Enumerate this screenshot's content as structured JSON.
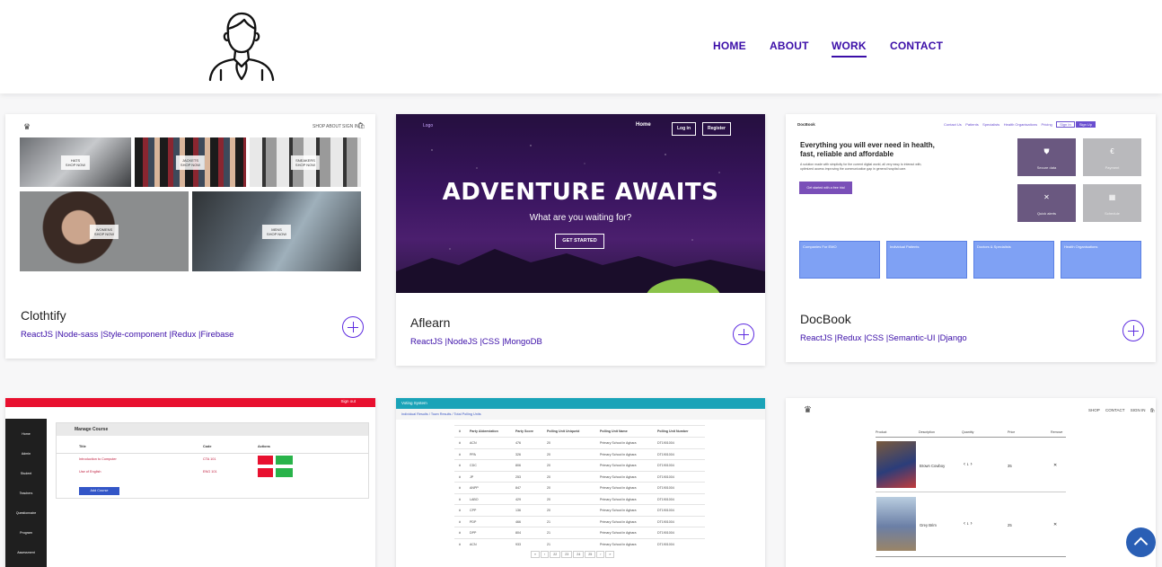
{
  "nav": {
    "items": [
      "HOME",
      "ABOUT",
      "WORK",
      "CONTACT"
    ],
    "active": "WORK"
  },
  "projects": [
    {
      "title": "Clothtify",
      "tags": "ReactJS |Node-sass |Style-component |Redux |Firebase",
      "thumb": {
        "nav": [
          "SHOP",
          "ABOUT",
          "SIGN IN"
        ],
        "tiles": [
          "HATS\nSHOP NOW",
          "JACKETS\nSHOP NOW",
          "SNEAKERS\nSHOP NOW",
          "WOMENS\nSHOP NOW",
          "MENS\nSHOP NOW"
        ]
      }
    },
    {
      "title": "Aflearn",
      "tags": "ReactJS |NodeJS |CSS |MongoDB",
      "thumb": {
        "logo_alt": "Logo",
        "nav": [
          "Home",
          "Log in",
          "Register"
        ],
        "heading": "ADVENTURE AWAITS",
        "subheading": "What are you waiting for?",
        "button": "GET STARTED"
      }
    },
    {
      "title": "DocBook",
      "tags": "ReactJS |Redux |CSS |Semantic-UI |Django",
      "thumb": {
        "brand": "DocBook",
        "nav": [
          "Contact Us",
          "Patients",
          "Specialists",
          "Health Organisations",
          "Pricing",
          "Sign In",
          "Sign Up"
        ],
        "heading": "Everything you will ever need in health, fast, reliable and affordable",
        "body": "A solution made with simplicity for the current digital world, all very easy to interact with, optimized access improving the communication gap in general hospital care.",
        "cta": "Get started with a free trial",
        "tiles": [
          "Secure data",
          "Payment",
          "Quick alerts",
          "Schedule"
        ],
        "cards": [
          "Companies For EMO",
          "Individual Patients",
          "Doctors & Specialists",
          "Health Organisations"
        ]
      }
    }
  ],
  "second_row": {
    "manage_course": {
      "title": "Manage Course",
      "sidebar": [
        "Home",
        "Admin",
        "Student",
        "Teachers",
        "Questionnaire",
        "Program",
        "Assessment"
      ],
      "columns": [
        "Title",
        "Code",
        "Actions"
      ],
      "rows": [
        [
          "Introduction to Computer",
          "CTA 101"
        ],
        [
          "Use of English",
          "ENG 101"
        ]
      ],
      "add_button": "Add Course",
      "topbar": "Sign out"
    },
    "voting": {
      "title": "Voting System",
      "breadcrumb": "Individual Results / Town Results / Total Polling Units",
      "columns": [
        "#",
        "Party Abbreviation",
        "Party Score",
        "Polling Unit Uniqueid",
        "Polling Unit Name",
        "Polling Unit Number"
      ],
      "rows": [
        [
          "#",
          "ACN",
          "476",
          "20",
          "Primary School in Aghara",
          "DT1901004"
        ],
        [
          "#",
          "PPA",
          "326",
          "20",
          "Primary School in Aghara",
          "DT1901004"
        ],
        [
          "#",
          "CDC",
          "806",
          "20",
          "Primary School in Aghara",
          "DT1901004"
        ],
        [
          "#",
          "JP",
          "253",
          "20",
          "Primary School in Aghara",
          "DT1901004"
        ],
        [
          "#",
          "ANPP",
          "847",
          "20",
          "Primary School in Aghara",
          "DT1901004"
        ],
        [
          "#",
          "LABO",
          "429",
          "20",
          "Primary School in Aghara",
          "DT1901004"
        ],
        [
          "#",
          "CPP",
          "136",
          "20",
          "Primary School in Aghara",
          "DT1901004"
        ],
        [
          "#",
          "PDP",
          "466",
          "21",
          "Primary School in Aghara",
          "DT1901004"
        ],
        [
          "#",
          "DPP",
          "804",
          "21",
          "Primary School in Aghara",
          "DT1901004"
        ],
        [
          "#",
          "ACN",
          "933",
          "21",
          "Primary School in Aghara",
          "DT1901004"
        ]
      ],
      "pager": [
        "«",
        "‹",
        "22",
        "23",
        "24",
        "25",
        "›",
        "»"
      ]
    },
    "checkout": {
      "nav": [
        "SHOP",
        "CONTACT",
        "SIGN IN"
      ],
      "columns": [
        "Product",
        "Description",
        "Quantity",
        "Price",
        "Remove"
      ],
      "items": [
        {
          "name": "Brown Cowboy",
          "qty": "1",
          "price": "35",
          "remove": "✕"
        },
        {
          "name": "Grey Brim",
          "qty": "1",
          "price": "25",
          "remove": "✕"
        }
      ]
    }
  }
}
